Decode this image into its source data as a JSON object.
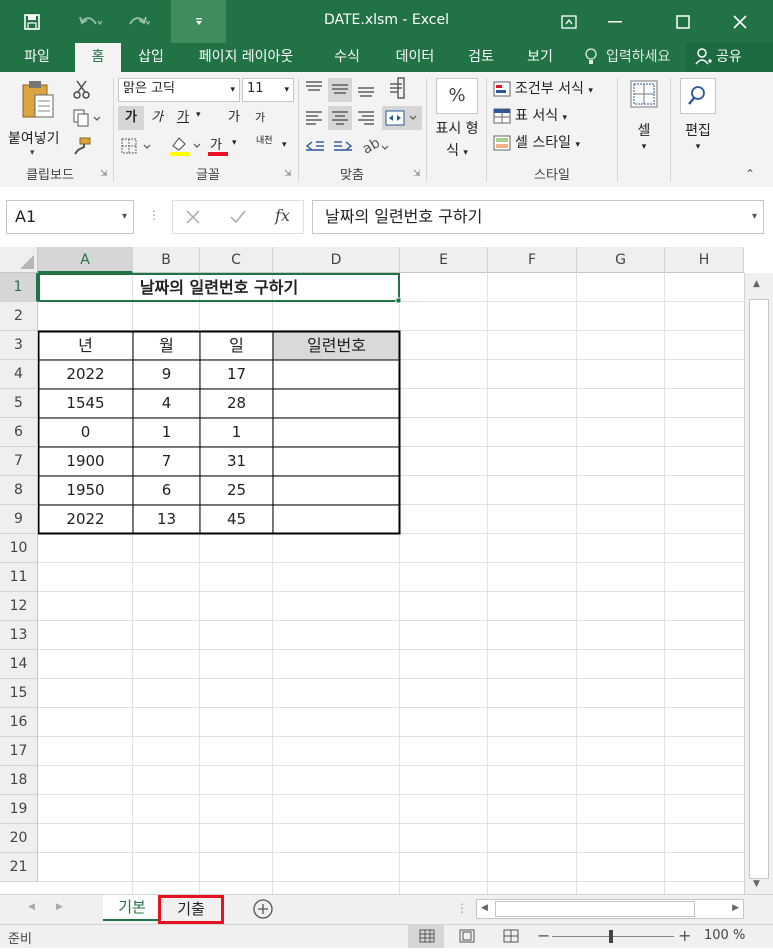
{
  "app": {
    "title": "DATE.xlsm  -  Excel"
  },
  "tabs": [
    "파일",
    "홈",
    "삽입",
    "페이지 레이아웃",
    "수식",
    "데이터",
    "검토",
    "보기"
  ],
  "tell_me": "입력하세요",
  "share": "공유",
  "ribbon": {
    "clipboard": {
      "paste": "붙여넣기",
      "label": "클립보드"
    },
    "font": {
      "name": "맑은 고딕",
      "size": "11",
      "label": "글꼴",
      "bold": "가",
      "italic": "가",
      "underline": "가",
      "grow": "가",
      "shrink": "가",
      "color_a": "가",
      "phonetic": "내천"
    },
    "alignment": {
      "label": "맞춤"
    },
    "number": {
      "format": "표시 형식",
      "percent": "%"
    },
    "styles": {
      "conditional": "조건부 서식",
      "table": "표 서식",
      "cell_style": "셀 스타일",
      "label": "스타일"
    },
    "cells": {
      "label": "셀"
    },
    "editing": {
      "label": "편집"
    }
  },
  "formula_bar": {
    "name_box": "A1",
    "content": "날짜의 일련번호 구하기",
    "fx": "fx"
  },
  "sheet": {
    "columns": [
      "A",
      "B",
      "C",
      "D",
      "E",
      "F",
      "G",
      "H"
    ],
    "rows": [
      "1",
      "2",
      "3",
      "4",
      "5",
      "6",
      "7",
      "8",
      "9",
      "10",
      "11",
      "12",
      "13",
      "14",
      "15",
      "16",
      "17",
      "18",
      "19",
      "20",
      "21"
    ],
    "title": "날짜의 일련번호 구하기",
    "headers": [
      "년",
      "월",
      "일",
      "일련번호"
    ],
    "data": [
      [
        "2022",
        "9",
        "17",
        ""
      ],
      [
        "1545",
        "4",
        "28",
        ""
      ],
      [
        "0",
        "1",
        "1",
        ""
      ],
      [
        "1900",
        "7",
        "31",
        ""
      ],
      [
        "1950",
        "6",
        "25",
        ""
      ],
      [
        "2022",
        "13",
        "45",
        ""
      ]
    ]
  },
  "sheet_tabs": [
    "기본",
    "기출"
  ],
  "status": {
    "ready": "준비",
    "zoom": "100 %"
  },
  "colors": {
    "excel_green": "#217346",
    "highlight_red": "#e81123"
  }
}
